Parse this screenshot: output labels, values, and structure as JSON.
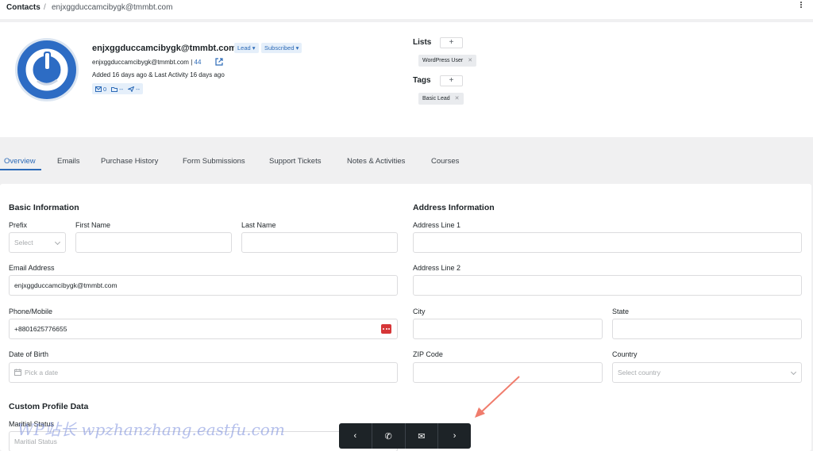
{
  "breadcrumb": {
    "root": "Contacts",
    "separator": "/",
    "current": "enjxggduccamcibygk@tmmbt.com"
  },
  "profile": {
    "email": "enjxggduccamcibygk@tmmbt.com",
    "status_pill": "Lead",
    "subscription_pill": "Subscribed",
    "secondary_email": "enjxggduccamcibygk@tmmbt.com",
    "separator": "|",
    "count": "44",
    "added_text": "Added 16 days ago & Last Activity 16 days ago",
    "stats": {
      "emails": "0",
      "purchases": "--",
      "sends": "--"
    }
  },
  "lists": {
    "label": "Lists",
    "add": "+",
    "items": [
      "WordPress User"
    ]
  },
  "tags": {
    "label": "Tags",
    "add": "+",
    "items": [
      "Basic Lead"
    ]
  },
  "tabs": [
    "Overview",
    "Emails",
    "Purchase History",
    "Form Submissions",
    "Support Tickets",
    "Notes & Activities",
    "Courses"
  ],
  "basic": {
    "title": "Basic Information",
    "prefix_label": "Prefix",
    "prefix_placeholder": "Select",
    "first_name_label": "First Name",
    "first_name_value": "",
    "last_name_label": "Last Name",
    "last_name_value": "",
    "email_label": "Email Address",
    "email_value": "enjxggduccamcibygk@tmmbt.com",
    "phone_label": "Phone/Mobile",
    "phone_value": "+8801625776655",
    "dob_label": "Date of Birth",
    "dob_placeholder": "Pick a date"
  },
  "address": {
    "title": "Address Information",
    "line1_label": "Address Line 1",
    "line2_label": "Address Line 2",
    "city_label": "City",
    "state_label": "State",
    "zip_label": "ZIP Code",
    "country_label": "Country",
    "country_placeholder": "Select country"
  },
  "custom": {
    "title": "Custom Profile Data",
    "marital_label": "Maritial Status",
    "marital_placeholder": "Maritial Status"
  },
  "bottom_nav": {
    "prev": "‹",
    "call": "✆",
    "mail": "✉",
    "next": "›"
  },
  "watermark": "WP站长 wpzhanzhang.eastfu.com",
  "colors": {
    "accent": "#2c6ab7",
    "avatar": "#2d6cc4",
    "danger": "#d63638",
    "arrow": "#f07c6c"
  }
}
